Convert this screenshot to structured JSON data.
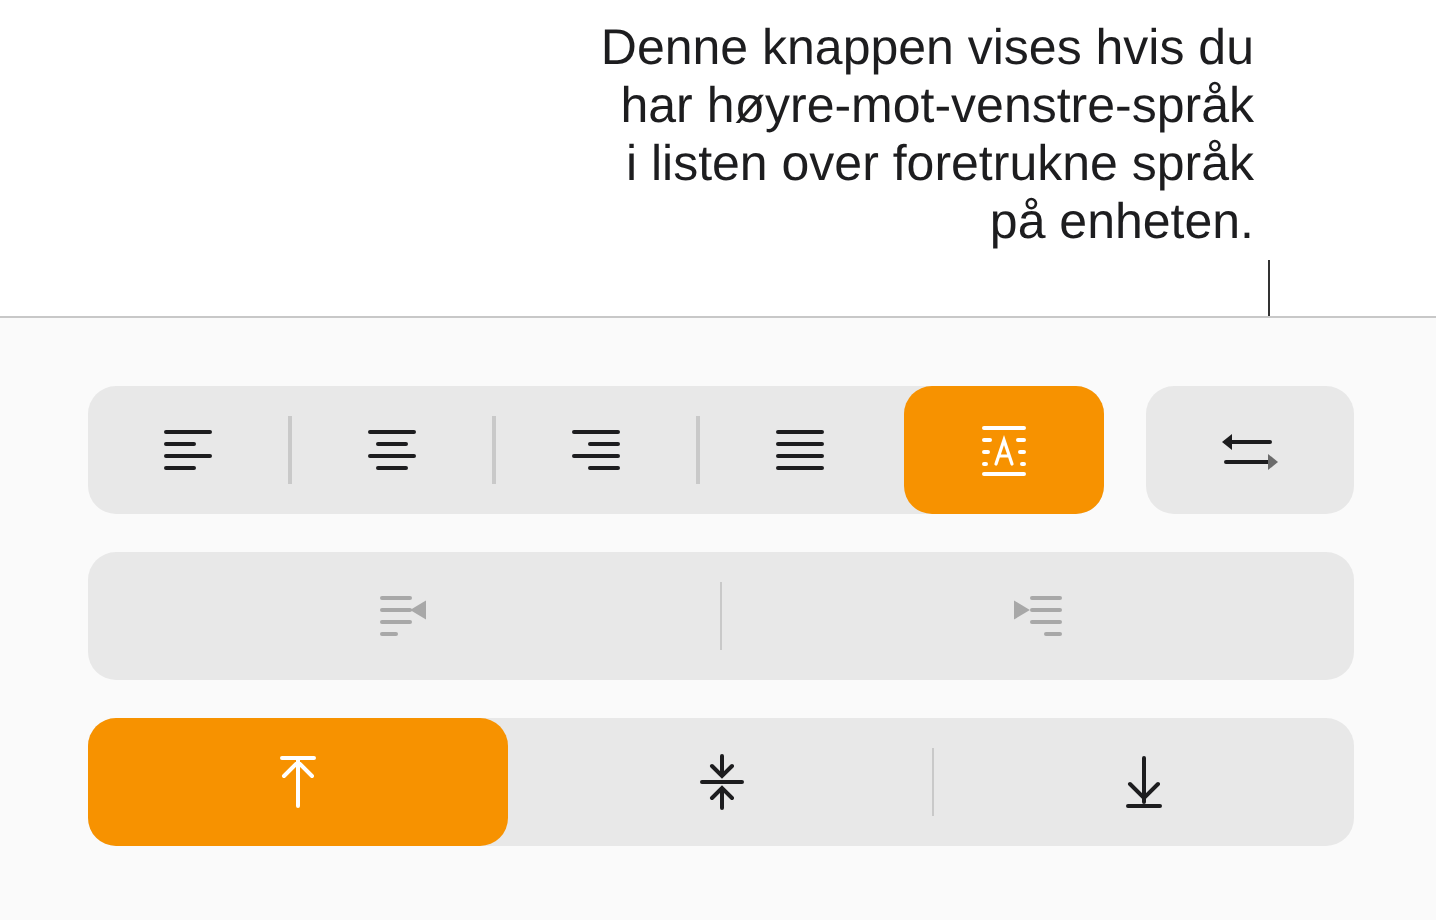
{
  "callout": {
    "lines": [
      "Denne knappen vises hvis du",
      "har høyre-mot-venstre-språk",
      "i listen over foretrukne språk",
      "på enheten."
    ]
  },
  "alignment": [
    {
      "kind": "left",
      "selected": false
    },
    {
      "kind": "center",
      "selected": false
    },
    {
      "kind": "right",
      "selected": false
    },
    {
      "kind": "justify",
      "selected": false
    },
    {
      "kind": "autofit",
      "selected": true
    }
  ],
  "direction_button": {
    "kind": "rtl"
  },
  "indent": [
    {
      "kind": "decrease",
      "disabled": true
    },
    {
      "kind": "increase",
      "disabled": true
    }
  ],
  "vertical_alignment": [
    {
      "kind": "top",
      "selected": true
    },
    {
      "kind": "middle",
      "selected": false
    },
    {
      "kind": "bottom",
      "selected": false
    }
  ]
}
